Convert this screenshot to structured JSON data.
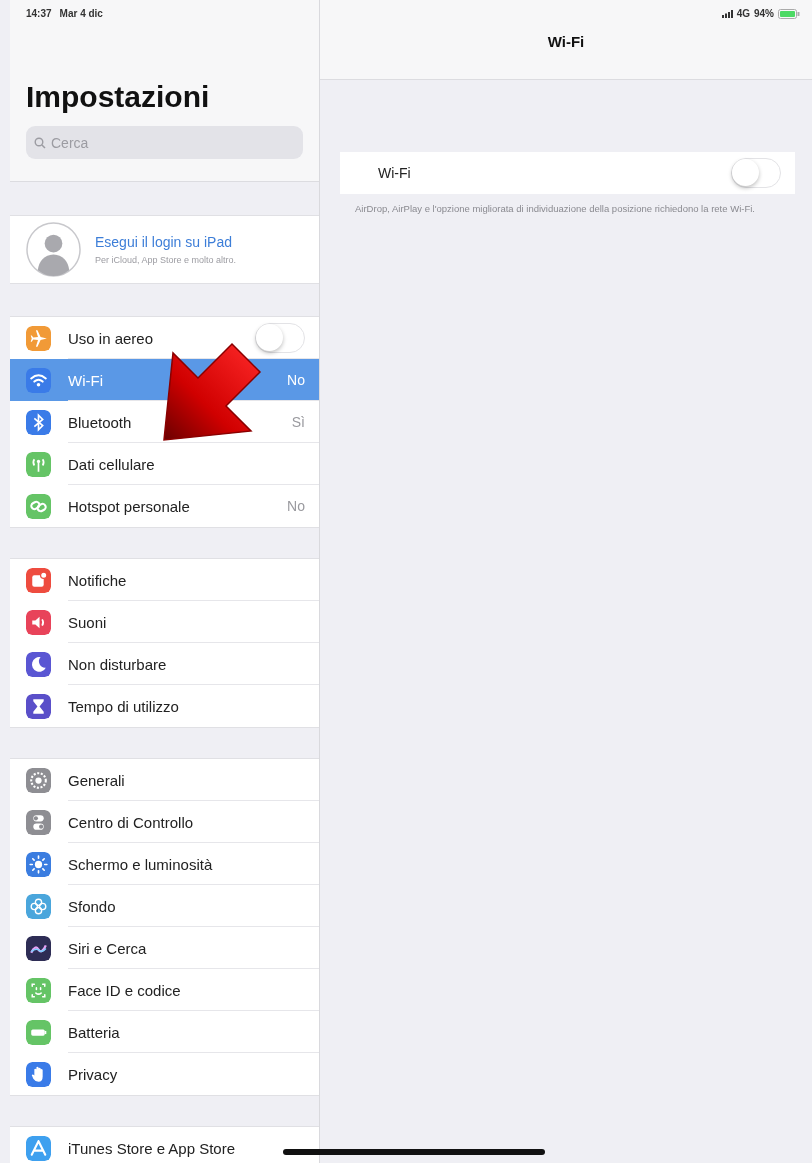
{
  "status_bar": {
    "time": "14:37",
    "date": "Mar 4 dic",
    "network": "4G",
    "battery": "94%"
  },
  "sidebar": {
    "title": "Impostazioni",
    "search": {
      "placeholder": "Cerca"
    },
    "account": {
      "title": "Esegui il login su iPad",
      "subtitle": "Per iCloud, App Store e molto altro."
    },
    "groups": [
      [
        {
          "label": "Uso in aereo",
          "kind": "toggle",
          "on": false,
          "selected": false,
          "color": "#f19a37"
        },
        {
          "label": "Wi-Fi",
          "kind": "link",
          "value": "No",
          "selected": true,
          "color": "#3a7be8"
        },
        {
          "label": "Bluetooth",
          "kind": "link",
          "value": "Sì",
          "selected": false,
          "color": "#3a7be8"
        },
        {
          "label": "Dati cellulare",
          "kind": "link",
          "selected": false,
          "color": "#65c466"
        },
        {
          "label": "Hotspot personale",
          "kind": "link",
          "value": "No",
          "selected": false,
          "color": "#65c466"
        }
      ],
      [
        {
          "label": "Notifiche",
          "kind": "link",
          "selected": false,
          "color": "#ee4c3f"
        },
        {
          "label": "Suoni",
          "kind": "link",
          "selected": false,
          "color": "#e8435a"
        },
        {
          "label": "Non disturbare",
          "kind": "link",
          "selected": false,
          "color": "#5a56d3"
        },
        {
          "label": "Tempo di utilizzo",
          "kind": "link",
          "selected": false,
          "color": "#5a4fc9"
        }
      ],
      [
        {
          "label": "Generali",
          "kind": "link",
          "selected": false,
          "color": "#8e8e93"
        },
        {
          "label": "Centro di Controllo",
          "kind": "link",
          "selected": false,
          "color": "#8e8e93"
        },
        {
          "label": "Schermo e luminosità",
          "kind": "link",
          "selected": false,
          "color": "#3b7de0"
        },
        {
          "label": "Sfondo",
          "kind": "link",
          "selected": false,
          "color": "#4aa6dc"
        },
        {
          "label": "Siri e Cerca",
          "kind": "link",
          "selected": false,
          "color": "#2e2d55"
        },
        {
          "label": "Face ID e codice",
          "kind": "link",
          "selected": false,
          "color": "#65c466"
        },
        {
          "label": "Batteria",
          "kind": "link",
          "selected": false,
          "color": "#65c466"
        },
        {
          "label": "Privacy",
          "kind": "link",
          "selected": false,
          "color": "#3a7be8"
        }
      ],
      [
        {
          "label": "iTunes Store e App Store",
          "kind": "link",
          "selected": false,
          "color": "#3ea0ef"
        }
      ]
    ]
  },
  "detail": {
    "title": "Wi-Fi",
    "rows": [
      {
        "label": "Wi-Fi",
        "kind": "toggle",
        "on": false
      }
    ],
    "footer": "AirDrop, AirPlay e l'opzione migliorata di individuazione della posizione richiedono la rete Wi-Fi."
  }
}
